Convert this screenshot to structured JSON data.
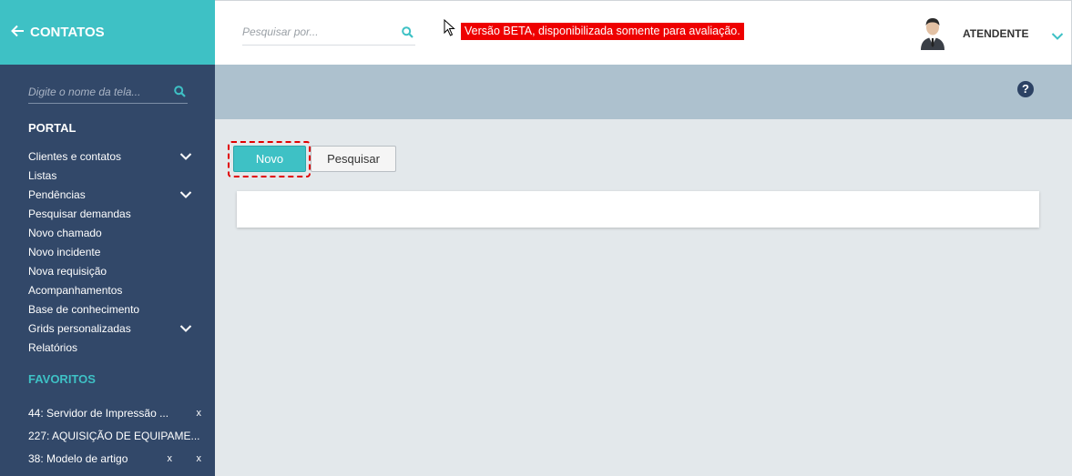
{
  "brand": {
    "back_icon": "arrow-left-icon",
    "title": "CONTATOS"
  },
  "sidebar": {
    "search_placeholder": "Digite o nome da tela...",
    "portal_title": "PORTAL",
    "items": [
      {
        "label": "Clientes e contatos",
        "expandable": true
      },
      {
        "label": "Listas",
        "expandable": false
      },
      {
        "label": "Pendências",
        "expandable": true
      },
      {
        "label": "Pesquisar demandas",
        "expandable": false
      },
      {
        "label": "Novo chamado",
        "expandable": false
      },
      {
        "label": "Novo incidente",
        "expandable": false
      },
      {
        "label": "Nova requisição",
        "expandable": false
      },
      {
        "label": "Acompanhamentos",
        "expandable": false
      },
      {
        "label": "Base de conhecimento",
        "expandable": false
      },
      {
        "label": "Grids personalizadas",
        "expandable": true
      },
      {
        "label": "Relatórios",
        "expandable": false
      }
    ],
    "favorites_title": "FAVORITOS",
    "favorites": [
      {
        "label": "44: Servidor de Impressão ...",
        "close": "x"
      },
      {
        "label": "227: AQUISIÇÃO DE EQUIPAME...",
        "close": ""
      },
      {
        "label": "38: Modelo de artigo",
        "close": "x",
        "close2": "x"
      }
    ]
  },
  "header": {
    "search_placeholder": "Pesquisar por...",
    "beta_notice": "Versão BETA, disponibilizada somente para avaliação.",
    "user_name": "ATENDENTE"
  },
  "subheader": {
    "help_label": "?"
  },
  "main": {
    "new_button": "Novo",
    "search_button": "Pesquisar"
  },
  "colors": {
    "accent": "#3ec1c5",
    "sidebar": "#324869",
    "beta": "#ee0000",
    "subheader": "#adc1ce"
  }
}
